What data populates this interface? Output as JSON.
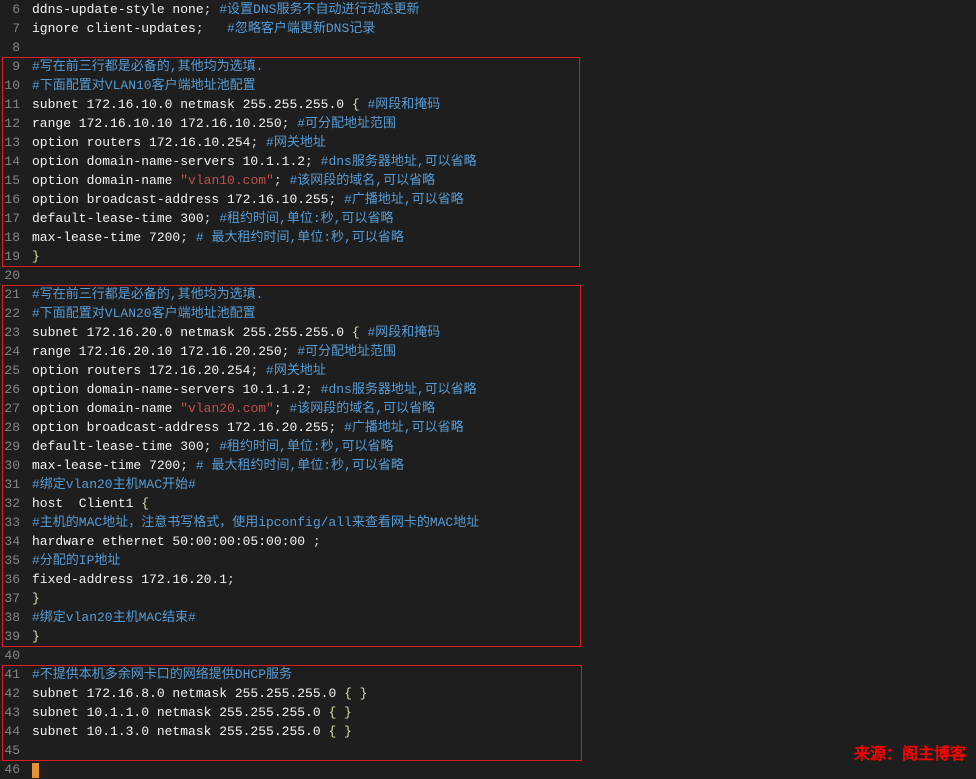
{
  "watermark": "来源：阁主博客",
  "lines": [
    {
      "num": 6,
      "tokens": [
        [
          "ddns-update-style none",
          "default"
        ],
        [
          "; ",
          "semi"
        ],
        [
          "#设置DNS服务不自动进行动态更新",
          "comment"
        ]
      ]
    },
    {
      "num": 7,
      "tokens": [
        [
          "ignore client-updates",
          "default"
        ],
        [
          ";   ",
          "semi"
        ],
        [
          "#忽略客户端更新DNS记录",
          "comment"
        ]
      ]
    },
    {
      "num": 8,
      "tokens": []
    },
    {
      "num": 9,
      "tokens": [
        [
          "#写在前三行都是必备的,其他均为选填.",
          "comment"
        ]
      ]
    },
    {
      "num": 10,
      "tokens": [
        [
          "#下面配置对VLAN10客户端地址池配置",
          "comment"
        ]
      ]
    },
    {
      "num": 11,
      "tokens": [
        [
          "subnet 172.16.10.0 netmask 255.255.255.0 ",
          "default"
        ],
        [
          "{",
          "brace"
        ],
        [
          " ",
          "default"
        ],
        [
          "#网段和掩码",
          "comment"
        ]
      ]
    },
    {
      "num": 12,
      "tokens": [
        [
          "range 172.16.10.10 172.16.10.250",
          "default"
        ],
        [
          "; ",
          "semi"
        ],
        [
          "#可分配地址范围",
          "comment"
        ]
      ]
    },
    {
      "num": 13,
      "tokens": [
        [
          "option routers 172.16.10.254",
          "default"
        ],
        [
          "; ",
          "semi"
        ],
        [
          "#网关地址",
          "comment"
        ]
      ]
    },
    {
      "num": 14,
      "tokens": [
        [
          "option domain-name-servers 10.1.1.2",
          "default"
        ],
        [
          "; ",
          "semi"
        ],
        [
          "#dns服务器地址,可以省略",
          "comment"
        ]
      ]
    },
    {
      "num": 15,
      "tokens": [
        [
          "option domain-name ",
          "default"
        ],
        [
          "\"vlan10.com\"",
          "string"
        ],
        [
          "; ",
          "semi"
        ],
        [
          "#该网段的域名,可以省略",
          "comment"
        ]
      ]
    },
    {
      "num": 16,
      "tokens": [
        [
          "option broadcast-address 172.16.10.255",
          "default"
        ],
        [
          "; ",
          "semi"
        ],
        [
          "#广播地址,可以省略",
          "comment"
        ]
      ]
    },
    {
      "num": 17,
      "tokens": [
        [
          "default-lease-time 300",
          "default"
        ],
        [
          "; ",
          "semi"
        ],
        [
          "#租约时间,单位:秒,可以省略",
          "comment"
        ]
      ]
    },
    {
      "num": 18,
      "tokens": [
        [
          "max-lease-time 7200",
          "default"
        ],
        [
          "; ",
          "semi"
        ],
        [
          "# 最大租约时间,单位:秒,可以省略",
          "comment"
        ]
      ]
    },
    {
      "num": 19,
      "tokens": [
        [
          "}",
          "brace"
        ]
      ]
    },
    {
      "num": 20,
      "tokens": []
    },
    {
      "num": 21,
      "tokens": [
        [
          "#写在前三行都是必备的,其他均为选填.",
          "comment"
        ]
      ]
    },
    {
      "num": 22,
      "tokens": [
        [
          "#下面配置对VLAN20客户端地址池配置",
          "comment"
        ]
      ]
    },
    {
      "num": 23,
      "tokens": [
        [
          "subnet 172.16.20.0 netmask 255.255.255.0 ",
          "default"
        ],
        [
          "{",
          "brace"
        ],
        [
          " ",
          "default"
        ],
        [
          "#网段和掩码",
          "comment"
        ]
      ]
    },
    {
      "num": 24,
      "tokens": [
        [
          "range 172.16.20.10 172.16.20.250",
          "default"
        ],
        [
          "; ",
          "semi"
        ],
        [
          "#可分配地址范围",
          "comment"
        ]
      ]
    },
    {
      "num": 25,
      "tokens": [
        [
          "option routers 172.16.20.254",
          "default"
        ],
        [
          "; ",
          "semi"
        ],
        [
          "#网关地址",
          "comment"
        ]
      ]
    },
    {
      "num": 26,
      "tokens": [
        [
          "option domain-name-servers 10.1.1.2",
          "default"
        ],
        [
          "; ",
          "semi"
        ],
        [
          "#dns服务器地址,可以省略",
          "comment"
        ]
      ]
    },
    {
      "num": 27,
      "tokens": [
        [
          "option domain-name ",
          "default"
        ],
        [
          "\"vlan20.com\"",
          "string"
        ],
        [
          "; ",
          "semi"
        ],
        [
          "#该网段的域名,可以省略",
          "comment"
        ]
      ]
    },
    {
      "num": 28,
      "tokens": [
        [
          "option broadcast-address 172.16.20.255",
          "default"
        ],
        [
          "; ",
          "semi"
        ],
        [
          "#广播地址,可以省略",
          "comment"
        ]
      ]
    },
    {
      "num": 29,
      "tokens": [
        [
          "default-lease-time 300",
          "default"
        ],
        [
          "; ",
          "semi"
        ],
        [
          "#租约时间,单位:秒,可以省略",
          "comment"
        ]
      ]
    },
    {
      "num": 30,
      "tokens": [
        [
          "max-lease-time 7200",
          "default"
        ],
        [
          "; ",
          "semi"
        ],
        [
          "# 最大租约时间,单位:秒,可以省略",
          "comment"
        ]
      ]
    },
    {
      "num": 31,
      "tokens": [
        [
          "#绑定vlan20主机MAC开始#",
          "comment"
        ]
      ]
    },
    {
      "num": 32,
      "tokens": [
        [
          "host  Client1 ",
          "default"
        ],
        [
          "{",
          "brace"
        ]
      ]
    },
    {
      "num": 33,
      "tokens": [
        [
          "#主机的MAC地址，注意书写格式，使用ipconfig/all来查看网卡的MAC地址",
          "comment"
        ]
      ]
    },
    {
      "num": 34,
      "tokens": [
        [
          "hardware ethernet 50:00:00:05:00:00 ",
          "default"
        ],
        [
          ";",
          "semi"
        ]
      ]
    },
    {
      "num": 35,
      "tokens": [
        [
          "#分配的IP地址",
          "comment"
        ]
      ]
    },
    {
      "num": 36,
      "tokens": [
        [
          "fixed-address 172.16.20.1",
          "default"
        ],
        [
          ";",
          "semi"
        ]
      ]
    },
    {
      "num": 37,
      "tokens": [
        [
          "}",
          "brace"
        ]
      ]
    },
    {
      "num": 38,
      "tokens": [
        [
          "#绑定vlan20主机MAC结束#",
          "comment"
        ]
      ]
    },
    {
      "num": 39,
      "tokens": [
        [
          "}",
          "brace"
        ]
      ]
    },
    {
      "num": 40,
      "tokens": []
    },
    {
      "num": 41,
      "tokens": [
        [
          "#不提供本机多余网卡口的网络提供DHCP服务",
          "comment"
        ]
      ]
    },
    {
      "num": 42,
      "tokens": [
        [
          "subnet 172.16.8.0 netmask 255.255.255.0 ",
          "default"
        ],
        [
          "{ }",
          "brace"
        ]
      ]
    },
    {
      "num": 43,
      "tokens": [
        [
          "subnet 10.1.1.0 netmask 255.255.255.0 ",
          "default"
        ],
        [
          "{ }",
          "brace"
        ]
      ]
    },
    {
      "num": 44,
      "tokens": [
        [
          "subnet 10.1.3.0 netmask 255.255.255.0 ",
          "default"
        ],
        [
          "{ }",
          "brace"
        ]
      ]
    },
    {
      "num": 45,
      "tokens": []
    },
    {
      "num": 46,
      "tokens": [],
      "cursor": true
    }
  ]
}
